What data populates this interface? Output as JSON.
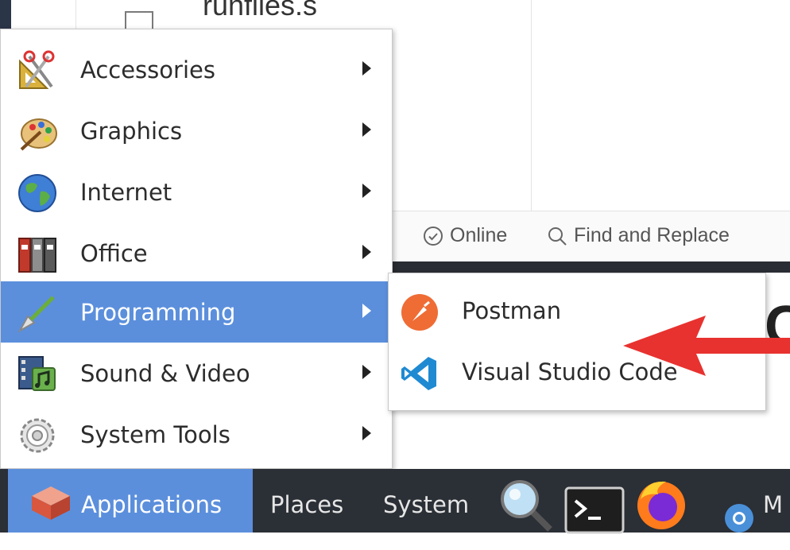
{
  "background": {
    "file_name": "runfiles.s",
    "status_online": "Online",
    "status_find_replace": "Find and Replace",
    "big_char": "C"
  },
  "menu": {
    "items": [
      {
        "label": "Accessories",
        "icon": "accessories-icon"
      },
      {
        "label": "Graphics",
        "icon": "graphics-icon"
      },
      {
        "label": "Internet",
        "icon": "internet-icon"
      },
      {
        "label": "Office",
        "icon": "office-icon"
      },
      {
        "label": "Programming",
        "icon": "programming-icon",
        "active": true
      },
      {
        "label": "Sound & Video",
        "icon": "sound-video-icon"
      },
      {
        "label": "System Tools",
        "icon": "system-tools-icon"
      }
    ]
  },
  "submenu": {
    "items": [
      {
        "label": "Postman",
        "icon": "postman-icon"
      },
      {
        "label": "Visual Studio Code",
        "icon": "vscode-icon"
      }
    ]
  },
  "taskbar": {
    "applications_label": "Applications",
    "places_label": "Places",
    "system_label": "System",
    "extra_label": "M"
  },
  "colors": {
    "accent": "#5b8fdc",
    "taskbar": "#2b2f36",
    "annotation": "#e8322f"
  }
}
